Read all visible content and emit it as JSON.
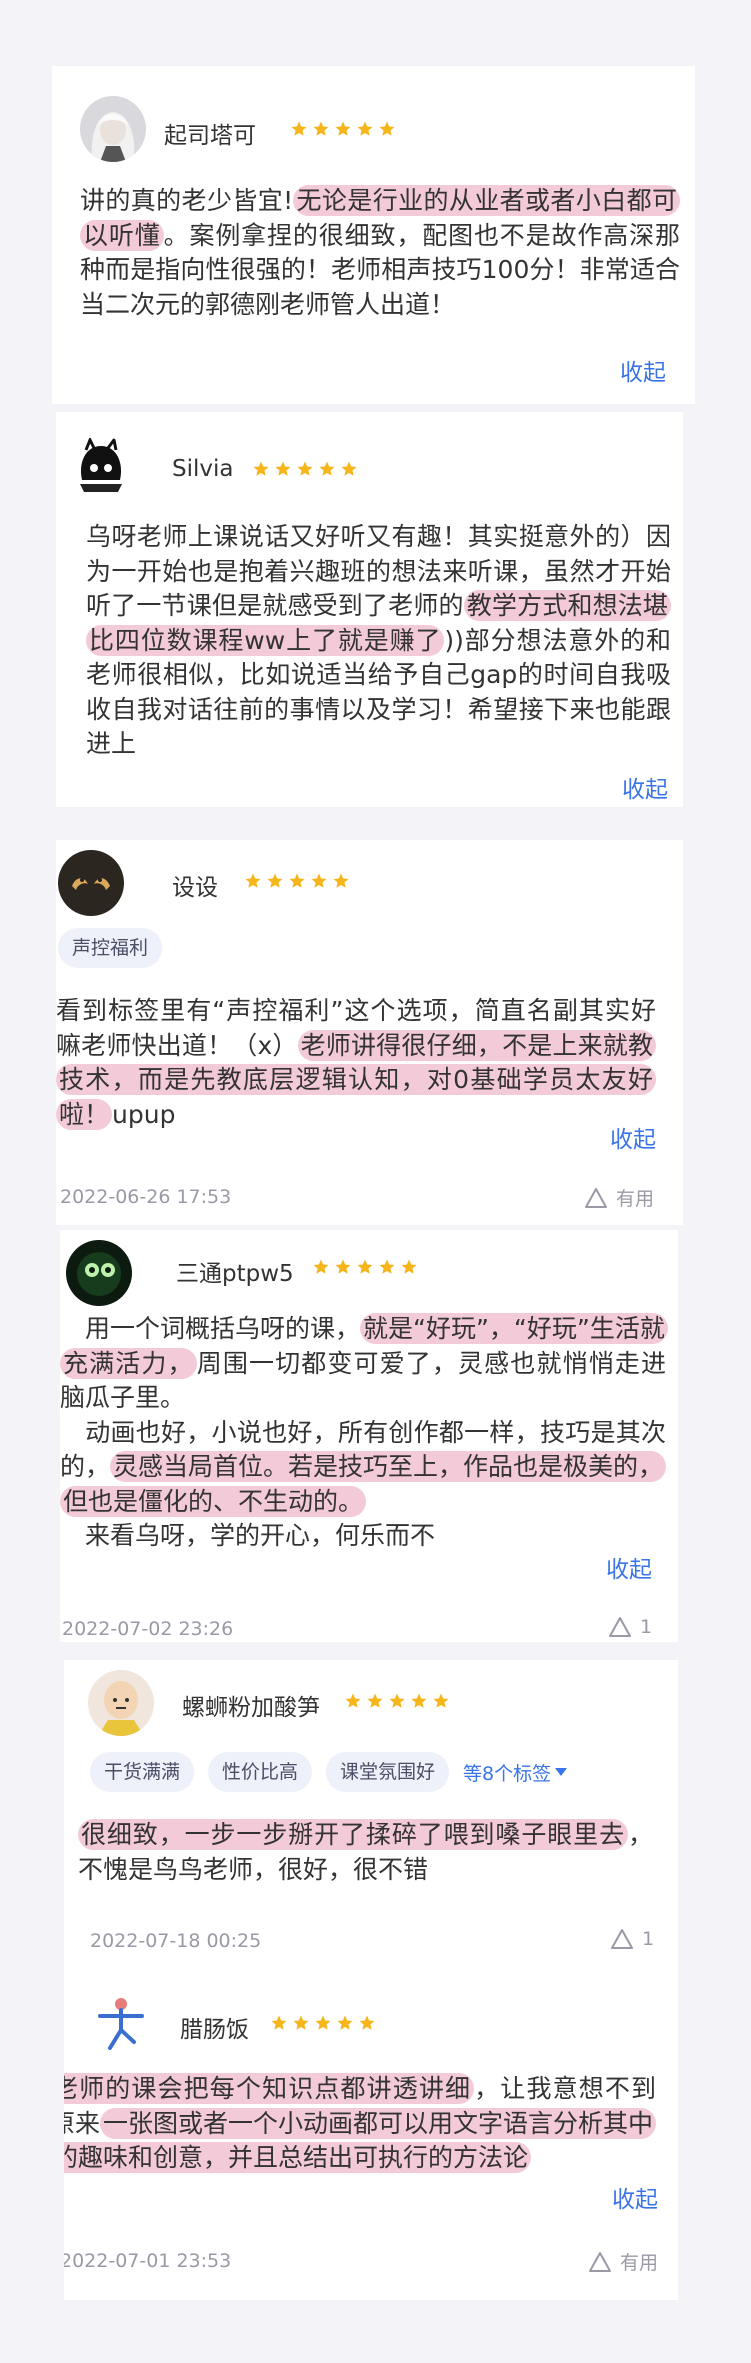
{
  "reviews": [
    {
      "user": "起司塔可",
      "avatar_icon": "silver-hair-character-avatar-icon",
      "rating": 5,
      "segments": [
        {
          "t": "讲的真的老少皆宜!",
          "h": false
        },
        {
          "t": "无论是行业的从业者或者小白都可以听懂",
          "h": true
        },
        {
          "t": "。案例拿捏的很细致，配图也不是故作高深那种而是指向性很强的！老师相声技巧100分！非常适合当二次元的郭德刚老师管人出道！",
          "h": false
        }
      ],
      "collapse": "收起"
    },
    {
      "user": "Silvia",
      "avatar_icon": "black-cat-sketch-avatar-icon",
      "rating": 5,
      "segments": [
        {
          "t": "乌呀老师上课说话又好听又有趣！其实挺意外的）因为一开始也是抱着兴趣班的想法来听课，虽然才开始听了一节课但是就感受到了老师的",
          "h": false
        },
        {
          "t": "教学方式和想法堪比四位数课程ww上了就是赚了",
          "h": true
        },
        {
          "t": "))部分想法意外的和老师很相似，比如说适当给予自己gap的时间自我吸收自我对话往前的事情以及学习！希望接下来也能跟进上",
          "h": false
        }
      ],
      "collapse": "收起"
    },
    {
      "user": "设设",
      "avatar_icon": "two-birds-avatar-icon",
      "rating": 5,
      "tags": [
        "声控福利"
      ],
      "segments": [
        {
          "t": "看到标签里有“声控福利”这个选项，简直名副其实好嘛老师快出道！（x）",
          "h": false
        },
        {
          "t": "老师讲得很仔细，不是上来就教技术，而是先教底层逻辑认知，对0基础学员太友好啦！",
          "h": true
        },
        {
          "t": "upup",
          "h": false
        }
      ],
      "collapse": "收起",
      "date": "2022-06-26 17:53",
      "useful": "有用"
    },
    {
      "user": "三通ptpw5",
      "avatar_icon": "green-eye-creature-avatar-icon",
      "rating": 5,
      "segments": [
        {
          "t": "　用一个词概括乌呀的课，",
          "h": false
        },
        {
          "t": "就是“好玩”，“好玩”生活就充满活力，",
          "h": true
        },
        {
          "t": "周围一切都变可爱了，灵感也就悄悄走进脑瓜子里。\n　动画也好，小说也好，所有创作都一样，技巧是其次的，",
          "h": false
        },
        {
          "t": "灵感当局首位。若是技巧至上，作品也是极美的，但也是僵化的、不生动的。",
          "h": true
        },
        {
          "t": "\n　来看乌呀，学的开心，何乐而不",
          "h": false
        }
      ],
      "collapse": "收起",
      "date": "2022-07-02 23:26",
      "useful": "1"
    },
    {
      "user": "螺蛳粉加酸笋",
      "avatar_icon": "bald-hero-avatar-icon",
      "rating": 5,
      "tags": [
        "干货满满",
        "性价比高",
        "课堂氛围好"
      ],
      "more_tags": "等8个标签",
      "segments": [
        {
          "t": "很细致，一步一步掰开了揉碎了喂到嗓子眼里去",
          "h": true
        },
        {
          "t": "，不愧是鸟鸟老师，很好，很不错",
          "h": false
        }
      ],
      "date": "2022-07-18 00:25",
      "useful": "1"
    },
    {
      "user": "腊肠饭",
      "avatar_icon": "yoga-figure-avatar-icon",
      "rating": 5,
      "segments": [
        {
          "t": "老师的课会把每个知识点都讲透讲细",
          "h": true
        },
        {
          "t": "，让我意想不到原来",
          "h": false
        },
        {
          "t": "一张图或者一个小动画都可以用文字语言分析其中的趣味和创意，并且总结出可执行的方法论",
          "h": true
        }
      ],
      "collapse": "收起",
      "date": "2022-07-01 23:53",
      "useful": "有用"
    }
  ],
  "colors": {
    "background": "#f3f3f8",
    "card": "#ffffff",
    "star": "#f5b51b",
    "highlight": "#f3cad8",
    "link": "#3b74e8",
    "meta": "#9a9aa6"
  }
}
